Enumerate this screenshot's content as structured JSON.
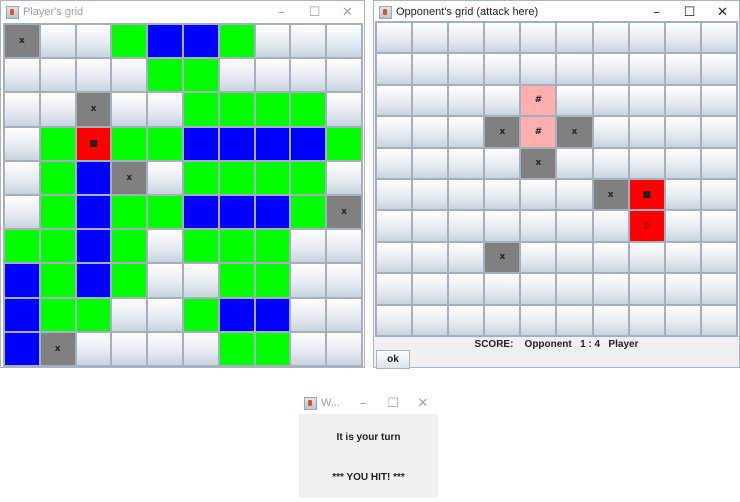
{
  "player_window": {
    "title": "Player's grid",
    "controls": {
      "minimize": "–",
      "maximize": "☐",
      "close": "✕"
    },
    "grid": [
      [
        "x",
        "w",
        "w",
        "g",
        "b",
        "b",
        "g",
        "w",
        "w",
        "w"
      ],
      [
        "w",
        "w",
        "w",
        "w",
        "g",
        "g",
        "w",
        "w",
        "w",
        "w"
      ],
      [
        "w",
        "w",
        "x",
        "w",
        "w",
        "g",
        "g",
        "g",
        "g",
        "w"
      ],
      [
        "w",
        "g",
        "r",
        "g",
        "g",
        "b",
        "b",
        "b",
        "b",
        "g"
      ],
      [
        "w",
        "g",
        "b",
        "x",
        "w",
        "g",
        "g",
        "g",
        "g",
        "w"
      ],
      [
        "w",
        "g",
        "b",
        "g",
        "g",
        "b",
        "b",
        "b",
        "g",
        "x"
      ],
      [
        "g",
        "g",
        "b",
        "g",
        "w",
        "g",
        "g",
        "g",
        "w",
        "w"
      ],
      [
        "b",
        "g",
        "b",
        "g",
        "w",
        "w",
        "g",
        "g",
        "w",
        "w"
      ],
      [
        "b",
        "g",
        "g",
        "w",
        "w",
        "g",
        "b",
        "b",
        "w",
        "w"
      ],
      [
        "b",
        "x",
        "w",
        "w",
        "w",
        "w",
        "g",
        "g",
        "w",
        "w"
      ]
    ],
    "marks": {
      "0,0": "x",
      "2,2": "x",
      "3,2": "■",
      "4,3": "x",
      "5,9": "x",
      "9,1": "x"
    }
  },
  "opponent_window": {
    "title": "Opponent's grid (attack here)",
    "controls": {
      "minimize": "–",
      "maximize": "☐",
      "close": "✕"
    },
    "grid": [
      [
        "w",
        "w",
        "w",
        "w",
        "w",
        "w",
        "w",
        "w",
        "w",
        "w"
      ],
      [
        "w",
        "w",
        "w",
        "w",
        "w",
        "w",
        "w",
        "w",
        "w",
        "w"
      ],
      [
        "w",
        "w",
        "w",
        "w",
        "p",
        "w",
        "w",
        "w",
        "w",
        "w"
      ],
      [
        "w",
        "w",
        "w",
        "x",
        "p",
        "x",
        "w",
        "w",
        "w",
        "w"
      ],
      [
        "w",
        "w",
        "w",
        "w",
        "x",
        "w",
        "w",
        "w",
        "w",
        "w"
      ],
      [
        "w",
        "w",
        "w",
        "w",
        "w",
        "w",
        "x",
        "r",
        "w",
        "w"
      ],
      [
        "w",
        "w",
        "w",
        "w",
        "w",
        "w",
        "w",
        "r",
        "w",
        "w"
      ],
      [
        "w",
        "w",
        "w",
        "x",
        "w",
        "w",
        "w",
        "w",
        "w",
        "w"
      ],
      [
        "w",
        "w",
        "w",
        "w",
        "w",
        "w",
        "w",
        "w",
        "w",
        "w"
      ],
      [
        "w",
        "w",
        "w",
        "w",
        "w",
        "w",
        "w",
        "w",
        "w",
        "w"
      ]
    ],
    "marks": {
      "2,4": "#",
      "3,3": "x",
      "3,4": "#",
      "3,5": "x",
      "4,4": "x",
      "5,6": "x",
      "5,7": "■",
      "6,7": "▯",
      "7,3": "x"
    },
    "score_text": "SCORE:    Opponent   1 : 4   Player",
    "ok_button": "ok"
  },
  "message_window": {
    "title": "W...",
    "controls": {
      "minimize": "–",
      "maximize": "☐",
      "close": "✕"
    },
    "line1": "It is your turn",
    "line2": "*** YOU HIT! ***"
  },
  "colors": {
    "ship_green": "#00ff00",
    "ship_blue": "#0000ff",
    "miss_gray": "#808080",
    "hit_red": "#ff0000",
    "hit_pink": "#ffafaf"
  }
}
